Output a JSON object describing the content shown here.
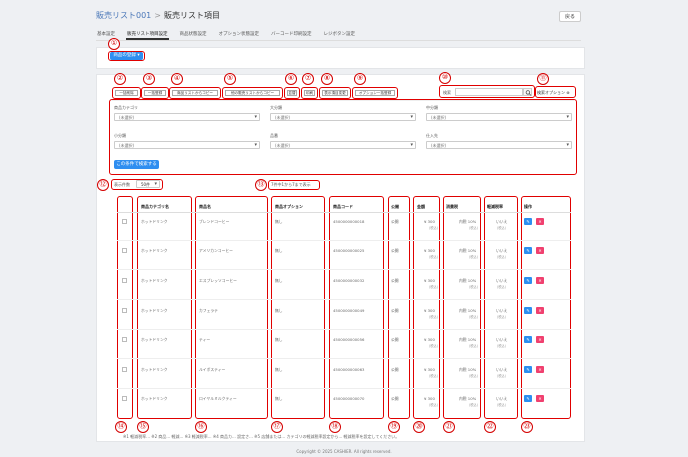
{
  "header": {
    "breadcrumb_parent": "販売リスト001",
    "breadcrumb_sep": ">",
    "breadcrumb_current": "販売リスト項目",
    "back_label": "戻る"
  },
  "tabs": [
    {
      "label": "基本設定"
    },
    {
      "label": "販売リスト項目設定"
    },
    {
      "label": "商品状態設定"
    },
    {
      "label": "オプション状態設定"
    },
    {
      "label": "バーコード印刷設定"
    },
    {
      "label": "レジボタン設定"
    }
  ],
  "product_register": {
    "label": "商品の登録 ▾"
  },
  "toolbar": {
    "bulk_delete": "一括削除",
    "bulk_register": "一括登録",
    "copy_from_product_list": "商品リストからコピー",
    "copy_from_other_sales_list": "他の販売リストからコピー",
    "sort": "並替",
    "print": "印刷",
    "display_change": "表示項目変更",
    "option_bulk_register": "オプション一括登録"
  },
  "search": {
    "label": "検索",
    "placeholder": "",
    "advanced_options": "検索オプション ⊕"
  },
  "filters": [
    {
      "label": "商品カテゴリ",
      "value": "(未選択)"
    },
    {
      "label": "大分類",
      "value": "(未選択)"
    },
    {
      "label": "中分類",
      "value": "(未選択)"
    },
    {
      "label": "小分類",
      "value": "(未選択)"
    },
    {
      "label": "品番",
      "value": "(未選択)"
    },
    {
      "label": "仕入先",
      "value": "(未選択)"
    }
  ],
  "filter_search_button": "この条件で検索する",
  "pagination": {
    "label": "表示件数",
    "value": "50件",
    "summary": "7件中1から7まで表示"
  },
  "table": {
    "headers": [
      "商品カテゴリ名",
      "商品名",
      "商品オプション",
      "商品コード",
      "公開",
      "金額",
      "消費税",
      "軽減税率",
      "操作"
    ],
    "rows": [
      {
        "category": "ホットドリンク",
        "name": "ブレンドコーヒー",
        "option": "無し",
        "code": "4500000000018",
        "public": "公開",
        "price": "¥ 300",
        "price_tax": "(税込)",
        "tax": "内税 10%",
        "tax_sub": "(税込)",
        "reduced": "いいえ",
        "reduced_sub": "(税込)"
      },
      {
        "category": "ホットドリンク",
        "name": "アメリカンコーヒー",
        "option": "無し",
        "code": "4500000000025",
        "public": "公開",
        "price": "¥ 300",
        "price_tax": "(税込)",
        "tax": "内税 10%",
        "tax_sub": "(税込)",
        "reduced": "いいえ",
        "reduced_sub": "(税込)"
      },
      {
        "category": "ホットドリンク",
        "name": "エスプレッソコーヒー",
        "option": "無し",
        "code": "4500000000032",
        "public": "公開",
        "price": "¥ 300",
        "price_tax": "(税込)",
        "tax": "内税 10%",
        "tax_sub": "(税込)",
        "reduced": "いいえ",
        "reduced_sub": "(税込)"
      },
      {
        "category": "ホットドリンク",
        "name": "カフェラテ",
        "option": "無し",
        "code": "4500000000049",
        "public": "公開",
        "price": "¥ 300",
        "price_tax": "(税込)",
        "tax": "内税 10%",
        "tax_sub": "(税込)",
        "reduced": "いいえ",
        "reduced_sub": "(税込)"
      },
      {
        "category": "ホットドリンク",
        "name": "ティー",
        "option": "無し",
        "code": "4500000000056",
        "public": "公開",
        "price": "¥ 300",
        "price_tax": "(税込)",
        "tax": "内税 10%",
        "tax_sub": "(税込)",
        "reduced": "いいえ",
        "reduced_sub": "(税込)"
      },
      {
        "category": "ホットドリンク",
        "name": "ルイボスティー",
        "option": "無し",
        "code": "4500000000063",
        "public": "公開",
        "price": "¥ 300",
        "price_tax": "(税込)",
        "tax": "内税 10%",
        "tax_sub": "(税込)",
        "reduced": "いいえ",
        "reduced_sub": "(税込)"
      },
      {
        "category": "ホットドリンク",
        "name": "ロイヤルミルクティー",
        "option": "無し",
        "code": "4500000000070",
        "public": "公開",
        "price": "¥ 300",
        "price_tax": "(税込)",
        "tax": "内税 10%",
        "tax_sub": "(税込)",
        "reduced": "いいえ",
        "reduced_sub": "(税込)"
      }
    ]
  },
  "note": "※1 軽減税率... ※2 商品... 軽減... ※3 軽減税率... ※4 商品カ... 設定さ... ※5 店舗または... カテゴリの軽減税率設定から... 軽減税率を設定してください。",
  "footer": "Copyright © 2025 CASHIER. All rights reserved.",
  "markers": [
    "①",
    "②",
    "③",
    "④",
    "⑤",
    "⑥",
    "⑦",
    "⑧",
    "⑨",
    "⑩",
    "⑪",
    "⑫",
    "⑬",
    "⑭",
    "⑮",
    "⑯",
    "⑰",
    "⑱",
    "⑲",
    "⑳",
    "㉑",
    "㉒",
    "㉓"
  ],
  "icons": {
    "search": "search-icon",
    "edit": "edit-icon",
    "delete": "delete-icon"
  }
}
